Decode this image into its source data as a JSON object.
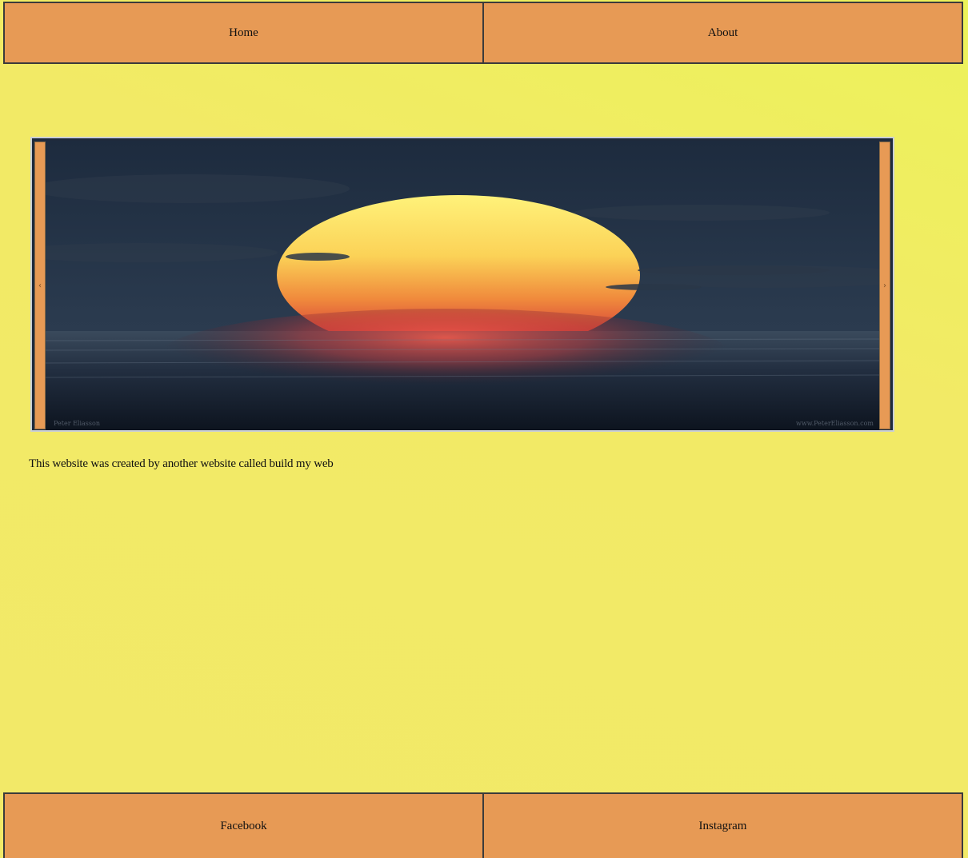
{
  "header_nav": {
    "home_label": "Home",
    "about_label": "About"
  },
  "slider": {
    "prev_icon": "chevron-left-icon",
    "next_icon": "chevron-right-icon",
    "prev_glyph": "‹",
    "next_glyph": "›",
    "image_subject": "sunset over the sea",
    "image_credit_left": "Peter Eliasson",
    "image_credit_right": "www.PeterEliasson.com"
  },
  "main": {
    "caption": "This website was created by another website called build my web"
  },
  "footer_nav": {
    "facebook_label": "Facebook",
    "instagram_label": "Instagram"
  },
  "colors": {
    "nav_bg": "#e79a55",
    "page_bg": "#f2e968",
    "border": "#3b3b3b"
  }
}
